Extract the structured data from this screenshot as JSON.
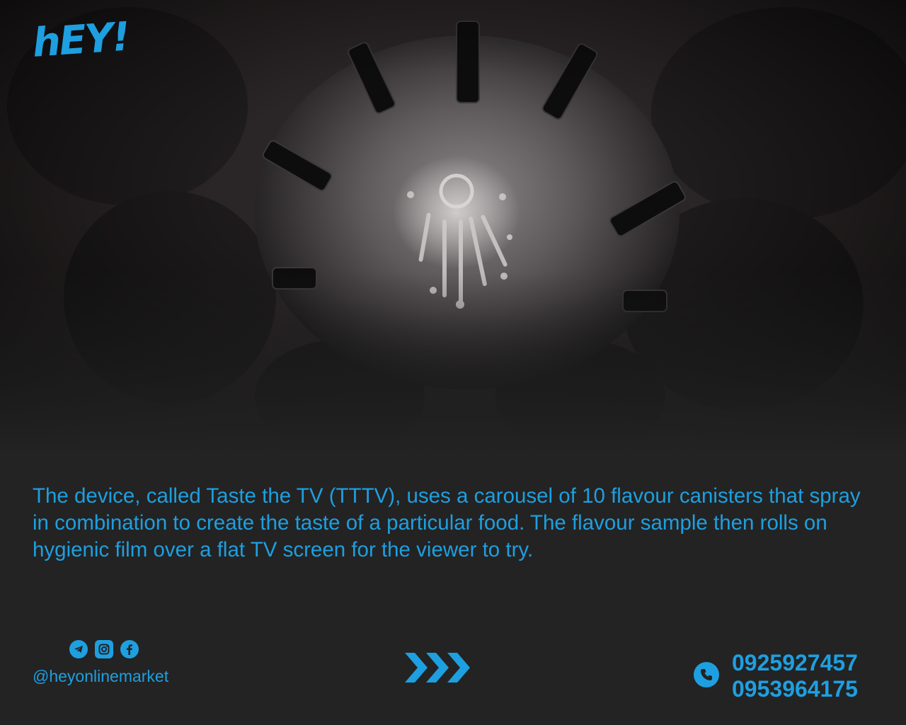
{
  "brand": {
    "logo_text": "hEY!",
    "accent_color": "#1e9fe0",
    "background_color": "#232323"
  },
  "photo": {
    "description_icon": "flavour-spray-photo"
  },
  "caption": {
    "text": "The device, called Taste the TV (TTTV), uses a carousel of 10 flavour canisters that spray in combination to create the taste of a particular food. The flavour sample then rolls on hygienic film over a flat TV screen for the viewer to try."
  },
  "footer": {
    "social_icons": [
      "telegram-icon",
      "instagram-icon",
      "facebook-icon"
    ],
    "handle": "@heyonlinemarket",
    "next_icon": "triple-chevron-right-icon",
    "phone_icon": "phone-icon",
    "phones": [
      "0925927457",
      "0953964175"
    ]
  }
}
